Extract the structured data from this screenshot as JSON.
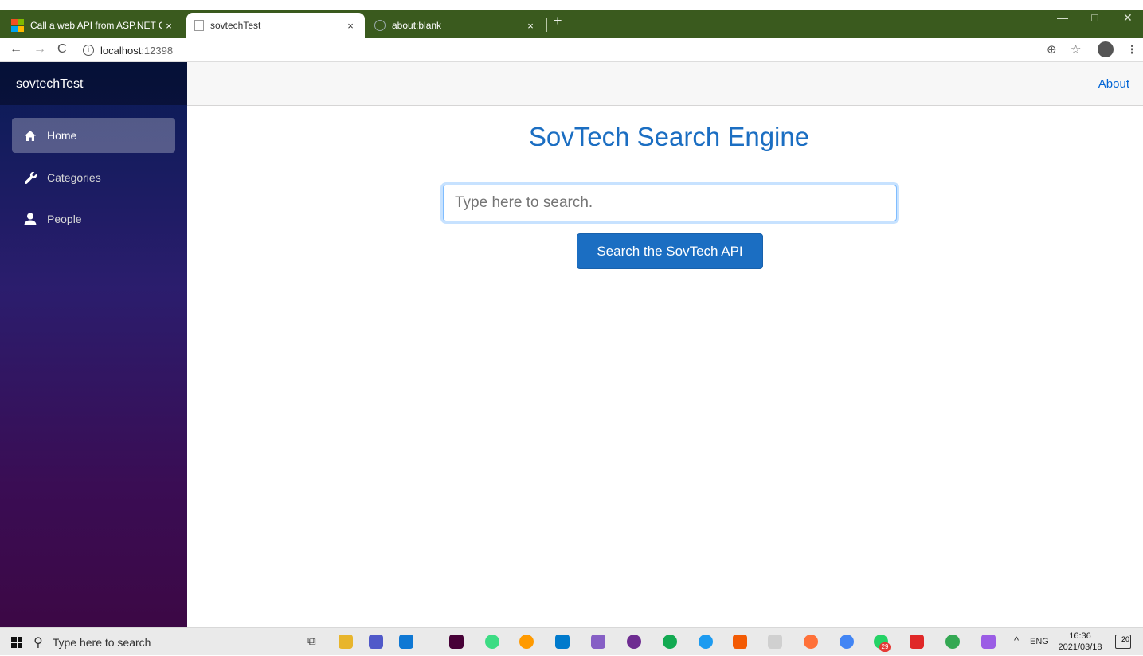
{
  "browser": {
    "tabs": [
      {
        "title": "Call a web API from ASP.NET Cor",
        "close": "×"
      },
      {
        "title": "sovtechTest",
        "close": "×"
      },
      {
        "title": "about:blank",
        "close": "×"
      }
    ],
    "new_tab": "+",
    "url_host": "localhost",
    "url_port": ":12398",
    "nav": {
      "back": "←",
      "forward": "→",
      "reload": "C"
    },
    "window": {
      "minimize": "—",
      "restore": "□",
      "close": "✕"
    }
  },
  "app": {
    "brand": "sovtechTest",
    "nav": [
      {
        "label": "Home",
        "icon": "home-icon",
        "active": true
      },
      {
        "label": "Categories",
        "icon": "wrench-icon",
        "active": false
      },
      {
        "label": "People",
        "icon": "person-icon",
        "active": false
      }
    ],
    "about": "About",
    "title": "SovTech Search Engine",
    "search_placeholder": "Type here to search.",
    "search_button": "Search the SovTech API",
    "accent": "#1b6ec2"
  },
  "taskbar": {
    "search_placeholder": "Type here to search",
    "badge_whatsapp": "29",
    "lang": "ENG",
    "time": "16:36",
    "date": "2021/03/18",
    "notifications": "20"
  }
}
